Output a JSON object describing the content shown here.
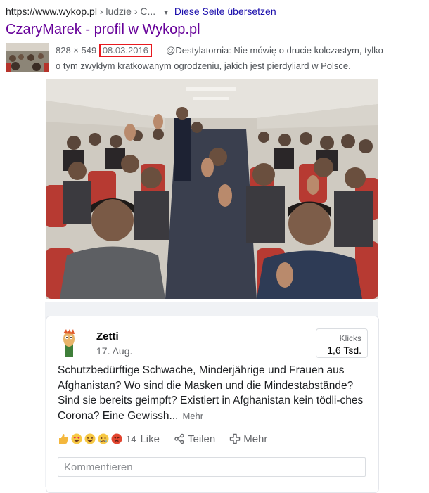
{
  "result": {
    "url_domain": "https://www.wykop.pl",
    "url_path": " › ludzie › C...",
    "translate_label": "Diese Seite übersetzen",
    "title": "CzaryMarek - profil w Wykop.pl",
    "image_size": "828 × 549",
    "date": "08.03.2016",
    "snippet_line1": "— @Destylatornia: Nie mówię o drucie kolczastym, tylko",
    "snippet_line2": "o tym zwykłym kratkowanym ogrodzeniu, jakich jest pierdyliard w Polsce."
  },
  "post": {
    "author": "Zetti",
    "date": "17. Aug.",
    "clicks_label": "Klicks",
    "clicks_value": "1,6 Tsd.",
    "text": "Schutzbedürftige Schwache, Minderjährige und Frauen aus Afghanistan? Wo sind die Masken und die Mindestabstände? Sind sie bereits geimpft? Existiert in Afghanistan kein tödli-ches Corona? Eine Gewissh...",
    "more_label": "Mehr",
    "reaction_count": "14",
    "like_label": "Like",
    "share_label": "Teilen",
    "more_action_label": "Mehr",
    "comment_placeholder": "Kommentieren"
  },
  "icons": {
    "reactions": [
      "thumbs-up-icon",
      "heart-eyes-icon",
      "laughing-icon",
      "crying-icon",
      "angry-icon"
    ],
    "share": "share-icon",
    "more": "plus-icon"
  },
  "colors": {
    "link_visited": "#660099",
    "link": "#1a0dab",
    "date_highlight": "#e8191f"
  }
}
